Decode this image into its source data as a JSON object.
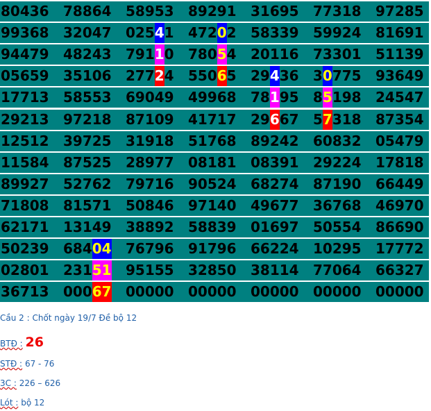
{
  "colors": {
    "row_background": "#008080",
    "row_separator": "#ffffff",
    "digit_text": "#000000",
    "highlight_blue": "#0000ff",
    "highlight_magenta": "#ff00ff",
    "highlight_red": "#ff0000",
    "highlight_text_white": "#ffffff",
    "highlight_text_yellow": "#ffff00",
    "note_text": "#1f5fa8",
    "btd_value": "#ee0000"
  },
  "rows": [
    [
      [
        {
          "t": "80436"
        }
      ],
      [
        {
          "t": "78864"
        }
      ],
      [
        {
          "t": "58953"
        }
      ],
      [
        {
          "t": "89291"
        }
      ],
      [
        {
          "t": "31695"
        }
      ],
      [
        {
          "t": "77318"
        }
      ],
      [
        {
          "t": "97285"
        }
      ]
    ],
    [
      [
        {
          "t": "99368"
        }
      ],
      [
        {
          "t": "32047"
        }
      ],
      [
        {
          "t": "025"
        },
        {
          "t": "4",
          "bg": "blue",
          "fg": "white"
        },
        {
          "t": "1"
        }
      ],
      [
        {
          "t": "472"
        },
        {
          "t": "0",
          "bg": "blue",
          "fg": "yellow"
        },
        {
          "t": "2"
        }
      ],
      [
        {
          "t": "58339"
        }
      ],
      [
        {
          "t": "59924"
        }
      ],
      [
        {
          "t": "81691"
        }
      ]
    ],
    [
      [
        {
          "t": "94479"
        }
      ],
      [
        {
          "t": "48243"
        }
      ],
      [
        {
          "t": "791"
        },
        {
          "t": "1",
          "bg": "pink",
          "fg": "white"
        },
        {
          "t": "0"
        }
      ],
      [
        {
          "t": "780"
        },
        {
          "t": "5",
          "bg": "pink",
          "fg": "yellow"
        },
        {
          "t": "4"
        }
      ],
      [
        {
          "t": "20116"
        }
      ],
      [
        {
          "t": "73301"
        }
      ],
      [
        {
          "t": "51139"
        }
      ]
    ],
    [
      [
        {
          "t": "05659"
        }
      ],
      [
        {
          "t": "35106"
        }
      ],
      [
        {
          "t": "277"
        },
        {
          "t": "2",
          "bg": "red",
          "fg": "white"
        },
        {
          "t": "4"
        }
      ],
      [
        {
          "t": "550"
        },
        {
          "t": "6",
          "bg": "red",
          "fg": "yellow"
        },
        {
          "t": "5"
        }
      ],
      [
        {
          "t": "29"
        },
        {
          "t": "4",
          "bg": "blue",
          "fg": "white"
        },
        {
          "t": "36"
        }
      ],
      [
        {
          "t": "3"
        },
        {
          "t": "0",
          "bg": "blue",
          "fg": "yellow"
        },
        {
          "t": "775"
        }
      ],
      [
        {
          "t": "93649"
        }
      ]
    ],
    [
      [
        {
          "t": "17713"
        }
      ],
      [
        {
          "t": "58553"
        }
      ],
      [
        {
          "t": "69049"
        }
      ],
      [
        {
          "t": "49968"
        }
      ],
      [
        {
          "t": "78"
        },
        {
          "t": "1",
          "bg": "pink",
          "fg": "white"
        },
        {
          "t": "95"
        }
      ],
      [
        {
          "t": "8"
        },
        {
          "t": "5",
          "bg": "pink",
          "fg": "yellow"
        },
        {
          "t": "198"
        }
      ],
      [
        {
          "t": "24547"
        }
      ]
    ],
    [
      [
        {
          "t": "29213"
        }
      ],
      [
        {
          "t": "97218"
        }
      ],
      [
        {
          "t": "87109"
        }
      ],
      [
        {
          "t": "41717"
        }
      ],
      [
        {
          "t": "29"
        },
        {
          "t": "6",
          "bg": "red",
          "fg": "white"
        },
        {
          "t": "67"
        }
      ],
      [
        {
          "t": "5"
        },
        {
          "t": "7",
          "bg": "red",
          "fg": "yellow"
        },
        {
          "t": "318"
        }
      ],
      [
        {
          "t": "87354"
        }
      ]
    ],
    [
      [
        {
          "t": "12512"
        }
      ],
      [
        {
          "t": "39725"
        }
      ],
      [
        {
          "t": "31918"
        }
      ],
      [
        {
          "t": "51768"
        }
      ],
      [
        {
          "t": "89242"
        }
      ],
      [
        {
          "t": "60832"
        }
      ],
      [
        {
          "t": "05479"
        }
      ]
    ],
    [
      [
        {
          "t": "11584"
        }
      ],
      [
        {
          "t": "87525"
        }
      ],
      [
        {
          "t": "28977"
        }
      ],
      [
        {
          "t": "08181"
        }
      ],
      [
        {
          "t": "08391"
        }
      ],
      [
        {
          "t": "29224"
        }
      ],
      [
        {
          "t": "17818"
        }
      ]
    ],
    [
      [
        {
          "t": "89927"
        }
      ],
      [
        {
          "t": "52762"
        }
      ],
      [
        {
          "t": "79716"
        }
      ],
      [
        {
          "t": "90524"
        }
      ],
      [
        {
          "t": "68274"
        }
      ],
      [
        {
          "t": "87190"
        }
      ],
      [
        {
          "t": "66449"
        }
      ]
    ],
    [
      [
        {
          "t": "71808"
        }
      ],
      [
        {
          "t": "81571"
        }
      ],
      [
        {
          "t": "50846"
        }
      ],
      [
        {
          "t": "97140"
        }
      ],
      [
        {
          "t": "49677"
        }
      ],
      [
        {
          "t": "36768"
        }
      ],
      [
        {
          "t": "46970"
        }
      ]
    ],
    [
      [
        {
          "t": "62171"
        }
      ],
      [
        {
          "t": "13149"
        }
      ],
      [
        {
          "t": "38892"
        }
      ],
      [
        {
          "t": "58839"
        }
      ],
      [
        {
          "t": "01697"
        }
      ],
      [
        {
          "t": "50554"
        }
      ],
      [
        {
          "t": "86690"
        }
      ]
    ],
    [
      [
        {
          "t": "50239"
        }
      ],
      [
        {
          "t": "684"
        },
        {
          "t": "04",
          "bg": "blue",
          "fg": "yellow"
        }
      ],
      [
        {
          "t": "76796"
        }
      ],
      [
        {
          "t": "91796"
        }
      ],
      [
        {
          "t": "66224"
        }
      ],
      [
        {
          "t": "10295"
        }
      ],
      [
        {
          "t": "17772"
        }
      ]
    ],
    [
      [
        {
          "t": "02801"
        }
      ],
      [
        {
          "t": "231"
        },
        {
          "t": "51",
          "bg": "pink",
          "fg": "yellow"
        }
      ],
      [
        {
          "t": "95155"
        }
      ],
      [
        {
          "t": "32850"
        }
      ],
      [
        {
          "t": "38114"
        }
      ],
      [
        {
          "t": "77064"
        }
      ],
      [
        {
          "t": "66327"
        }
      ]
    ],
    [
      [
        {
          "t": "36713"
        }
      ],
      [
        {
          "t": "000"
        },
        {
          "t": "67",
          "bg": "red",
          "fg": "yellow"
        }
      ],
      [
        {
          "t": "00000"
        }
      ],
      [
        {
          "t": "00000"
        }
      ],
      [
        {
          "t": "00000"
        }
      ],
      [
        {
          "t": "00000"
        }
      ],
      [
        {
          "t": "00000"
        }
      ]
    ]
  ],
  "notes": {
    "cau": "Cầu 2 : Chốt ngày 19/7 Đề bộ 12",
    "btd_label": "BTĐ :",
    "btd_value": "26",
    "std_label": "STĐ :",
    "std_value": "67 - 76",
    "threec_label": "3C :",
    "threec_value": "226  – 626",
    "lot_label": "Lót :",
    "lot_value": "bộ 12"
  }
}
